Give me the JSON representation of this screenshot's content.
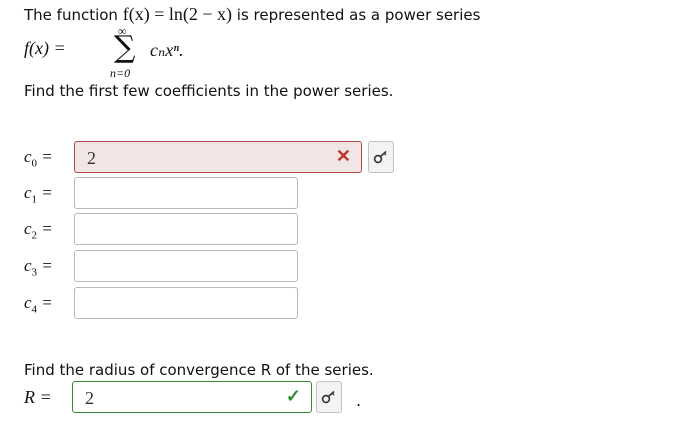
{
  "intro": {
    "prefix": "The function",
    "function_expr": "f(x) = ln(2 − x)",
    "suffix": "is represented as a power series"
  },
  "series": {
    "lhs": "f(x) =",
    "sigma": "∑",
    "upper": "∞",
    "lower": "n=0",
    "term": "cₙxⁿ."
  },
  "coef_prompt": "Find the first few coefficients in the power series.",
  "coefficients": [
    {
      "label": "c",
      "index": "0",
      "value": "2",
      "status": "incorrect"
    },
    {
      "label": "c",
      "index": "1",
      "value": "",
      "status": "none"
    },
    {
      "label": "c",
      "index": "2",
      "value": "",
      "status": "none"
    },
    {
      "label": "c",
      "index": "3",
      "value": "",
      "status": "none"
    },
    {
      "label": "c",
      "index": "4",
      "value": "",
      "status": "none"
    }
  ],
  "radius_prompt": "Find the radius of convergence R of the series.",
  "radius": {
    "label": "R =",
    "value": "2",
    "status": "correct",
    "trailing": "."
  },
  "icons": {
    "incorrect": "x-mark-icon",
    "correct": "check-mark-icon",
    "key": "key-icon"
  },
  "colors": {
    "incorrect": "#c0342c",
    "correct": "#2e8b2e",
    "error_bg": "#f1e5e5"
  }
}
